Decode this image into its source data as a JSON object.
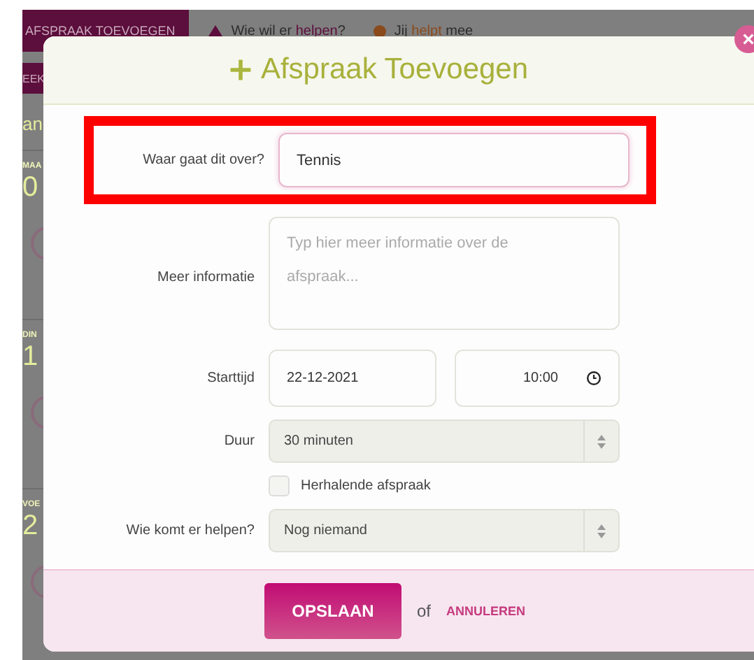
{
  "background_page": {
    "add_button": "AFSPRAAK TOEVOEGEN",
    "legend": [
      {
        "kind": "triangle",
        "text": "Wie wil er **helpen**?"
      },
      {
        "kind": "dot",
        "text": "Jij **helpt** mee"
      }
    ],
    "sidebar": [
      {
        "kind": "tab",
        "text": "EEK"
      },
      {
        "kind": "heading",
        "text": "an"
      },
      {
        "kind": "day",
        "label": "MAA",
        "number": "0"
      },
      {
        "kind": "day",
        "label": "DIN",
        "number": "1"
      },
      {
        "kind": "day",
        "label": "VOE",
        "number": "2"
      }
    ]
  },
  "dialog": {
    "close": "×",
    "title": "Afspraak Toevoegen",
    "fields": [
      {
        "kind": "text",
        "label": "Waar gaat dit over?",
        "value": "Tennis",
        "highlighted": true
      },
      {
        "kind": "textarea",
        "label": "Meer informatie",
        "placeholder": "Typ hier meer informatie over de afspraak..."
      },
      {
        "kind": "datetime",
        "label": "Starttijd",
        "date": "22-12-2021",
        "time": "10:00"
      },
      {
        "kind": "select",
        "label": "Duur",
        "value": "30 minuten"
      },
      {
        "kind": "checkbox",
        "label": "Herhalende afspraak",
        "checked": false
      },
      {
        "kind": "select",
        "label": "Wie komt er helpen?",
        "value": "Nog niemand"
      }
    ],
    "save": "OPSLAAN",
    "separator": "of",
    "cancel": "ANNULEREN"
  }
}
